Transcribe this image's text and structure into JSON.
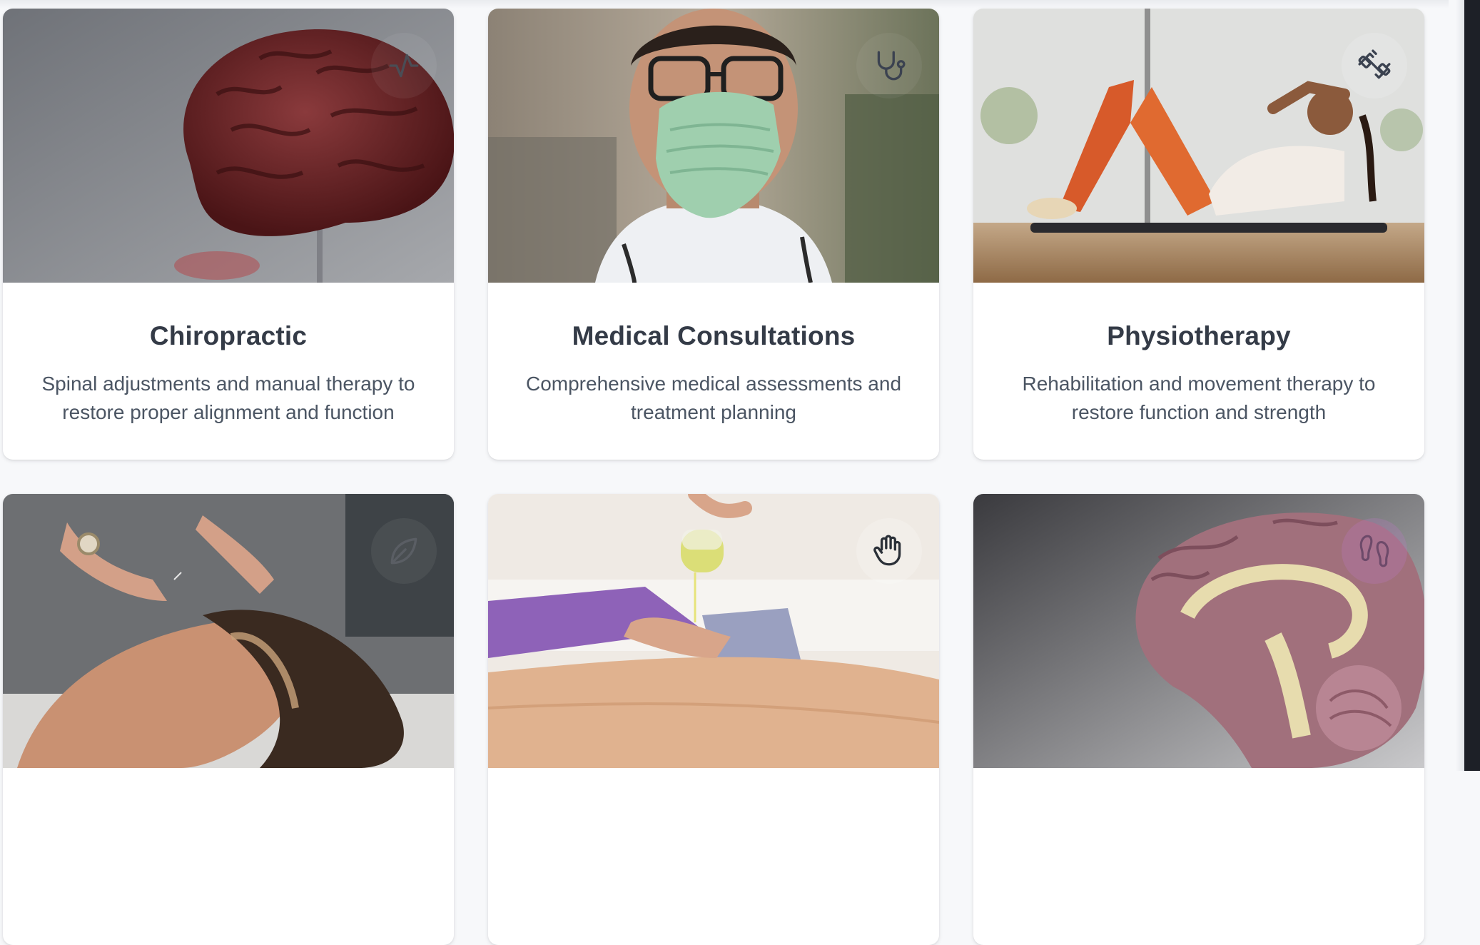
{
  "services": [
    {
      "title": "Chiropractic",
      "description": "Spinal adjustments and manual therapy to restore proper alignment and function",
      "icon": "activity-icon",
      "image": "brain-model-photo"
    },
    {
      "title": "Medical Consultations",
      "description": "Comprehensive medical assessments and treatment planning",
      "icon": "stethoscope-icon",
      "image": "masked-doctor-photo"
    },
    {
      "title": "Physiotherapy",
      "description": "Rehabilitation and movement therapy to restore function and strength",
      "icon": "dumbbell-icon",
      "image": "woman-doing-crunches-photo"
    },
    {
      "title": "",
      "description": "",
      "icon": "leaf-icon",
      "image": "acupuncture-face-photo"
    },
    {
      "title": "",
      "description": "",
      "icon": "hand-icon",
      "image": "oil-massage-photo"
    },
    {
      "title": "",
      "description": "",
      "icon": "footprints-icon",
      "image": "brain-cross-section-photo"
    }
  ],
  "colors": {
    "page_background": "#f7f8fa",
    "card_background": "#ffffff",
    "title_text": "#343b47",
    "description_text": "#4b5563",
    "icon_stroke": "#3b4250"
  }
}
